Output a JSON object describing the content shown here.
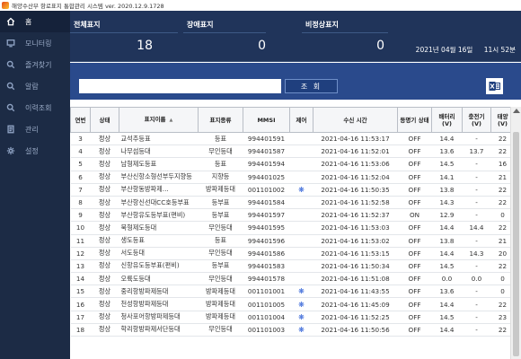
{
  "window": {
    "title": "해양수산부 항로표지 통합관리 시스템 ver. 2020.12.9.1728"
  },
  "sidebar": {
    "items": [
      {
        "label": "홈",
        "icon": "home-icon"
      },
      {
        "label": "모니터링",
        "icon": "monitor-icon"
      },
      {
        "label": "즐겨찾기",
        "icon": "search-icon"
      },
      {
        "label": "알람",
        "icon": "search-icon"
      },
      {
        "label": "이력조회",
        "icon": "search-icon"
      },
      {
        "label": "관리",
        "icon": "document-icon"
      },
      {
        "label": "설정",
        "icon": "gear-icon"
      }
    ]
  },
  "summary": {
    "total_label": "전체표지",
    "total_value": "18",
    "fault_label": "장애표지",
    "fault_value": "0",
    "abnormal_label": "비정상표지",
    "abnormal_value": "0",
    "date": "2021년 04월 16일",
    "time": "11시 52분"
  },
  "search": {
    "value": "",
    "button_label": "조 회",
    "excel_icon": "excel-export-icon"
  },
  "table": {
    "headers": [
      "연번",
      "상태",
      "표지이름",
      "표지종류",
      "MMSI",
      "제어",
      "수신 시간",
      "등명기 상태",
      "배터리 (V)",
      "충전기 (V)",
      "태양 (V)"
    ],
    "rows": [
      [
        "3",
        "정상",
        "교석추등표",
        "등표",
        "994401591",
        "",
        "2021-04-16 11:53:17",
        "OFF",
        "14.4",
        "-",
        "22"
      ],
      [
        "4",
        "정상",
        "나무섬등대",
        "무인등대",
        "994401587",
        "",
        "2021-04-16 11:52:01",
        "OFF",
        "13.6",
        "13.7",
        "22"
      ],
      [
        "5",
        "정상",
        "남형제도등표",
        "등표",
        "994401594",
        "",
        "2021-04-16 11:53:06",
        "OFF",
        "14.5",
        "-",
        "16"
      ],
      [
        "6",
        "정상",
        "부산신항소형선부두지향등",
        "지향등",
        "994401025",
        "",
        "2021-04-16 11:52:04",
        "OFF",
        "14.1",
        "-",
        "21"
      ],
      [
        "7",
        "정상",
        "부산항동방파제...",
        "방파제등대",
        "001101002",
        "star",
        "2021-04-16 11:50:35",
        "OFF",
        "13.8",
        "-",
        "22"
      ],
      [
        "8",
        "정상",
        "부산항신선대CC호등부표",
        "등부표",
        "994401584",
        "",
        "2021-04-16 11:52:58",
        "OFF",
        "14.3",
        "-",
        "22"
      ],
      [
        "9",
        "정상",
        "부산항유도등부표(편비)",
        "등부표",
        "994401597",
        "",
        "2021-04-16 11:52:37",
        "ON",
        "12.9",
        "-",
        "0"
      ],
      [
        "10",
        "정상",
        "북형제도등대",
        "무인등대",
        "994401595",
        "",
        "2021-04-16 11:53:03",
        "OFF",
        "14.4",
        "14.4",
        "22"
      ],
      [
        "11",
        "정상",
        "생도등표",
        "등표",
        "994401596",
        "",
        "2021-04-16 11:53:02",
        "OFF",
        "13.8",
        "-",
        "21"
      ],
      [
        "12",
        "정상",
        "서도등대",
        "무인등대",
        "994401586",
        "",
        "2021-04-16 11:53:15",
        "OFF",
        "14.4",
        "14.3",
        "20"
      ],
      [
        "13",
        "정상",
        "신항유도등부표(편비)",
        "등부표",
        "994401583",
        "",
        "2021-04-16 11:50:34",
        "OFF",
        "14.5",
        "-",
        "22"
      ],
      [
        "14",
        "정상",
        "오륙도등대",
        "무인등대",
        "994401578",
        "",
        "2021-04-16 11:51:08",
        "OFF",
        "0.0",
        "0.0",
        "0"
      ],
      [
        "15",
        "정상",
        "중리항방파제등대",
        "방파제등대",
        "001101001",
        "star",
        "2021-04-16 11:43:55",
        "OFF",
        "13.6",
        "-",
        "0"
      ],
      [
        "16",
        "정상",
        "천성항방파제등대",
        "방파제등대",
        "001101005",
        "star",
        "2021-04-16 11:45:09",
        "OFF",
        "14.4",
        "-",
        "22"
      ],
      [
        "17",
        "정상",
        "청사포어항방파제등대",
        "방파제등대",
        "001101004",
        "star",
        "2021-04-16 11:52:25",
        "OFF",
        "14.5",
        "-",
        "23"
      ],
      [
        "18",
        "정상",
        "학리항방파제서단등대",
        "무인등대",
        "001101003",
        "star",
        "2021-04-16 11:50:56",
        "OFF",
        "14.4",
        "-",
        "22"
      ]
    ]
  },
  "colors": {
    "sidebar": "#1c2b45",
    "topbar": "#20345a",
    "searchbar": "#2a4a8c",
    "control_star": "#2c5ed6"
  }
}
